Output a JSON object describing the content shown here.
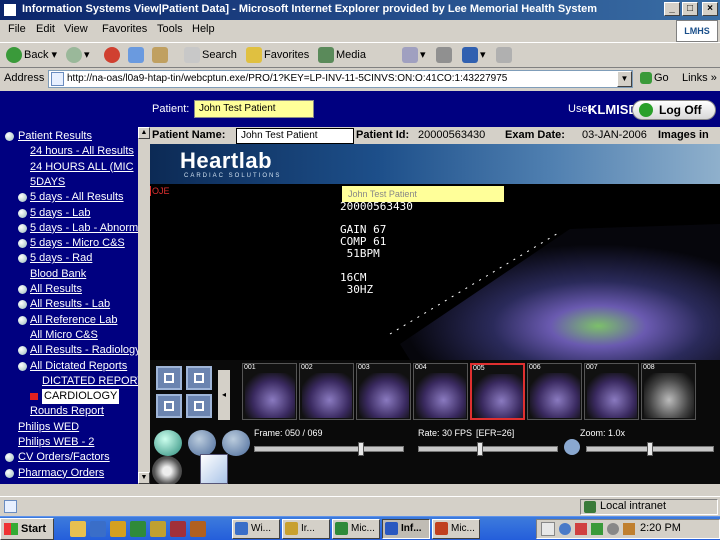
{
  "window": {
    "title": "Information Systems View|Patient Data] - Microsoft Internet Explorer provided by Lee Memorial Health System",
    "brand_badge": "LMHS"
  },
  "menu": [
    "File",
    "Edit",
    "View",
    "Favorites",
    "Tools",
    "Help"
  ],
  "toolbar": {
    "back": "Back",
    "search": "Search",
    "favorites": "Favorites",
    "media": "Media"
  },
  "address": {
    "label": "Address",
    "url": "http://na-oas/l0a9-htap-tin/webcptun.exe/PRO/1?KEY=LP-INV-11-5CINVS:ON:O:41CO:1:43227975",
    "go": "Go",
    "links": "Links"
  },
  "app": {
    "patient_label": "Patient:",
    "patient_value": "John Test Patient",
    "user_label": "User:",
    "user_value": "KLMISD",
    "logoff": "Log Off"
  },
  "sidebar": {
    "items": [
      {
        "label": "Patient Results",
        "bullet": true,
        "indent": 0
      },
      {
        "label": "24 hours - All Results",
        "bullet": false,
        "indent": 1
      },
      {
        "label": "24 HOURS ALL (MIC",
        "bullet": false,
        "indent": 1
      },
      {
        "label": "5DAYS",
        "bullet": false,
        "indent": 1
      },
      {
        "label": "5 days - All Results",
        "bullet": true,
        "indent": 1
      },
      {
        "label": "5 days - Lab",
        "bullet": true,
        "indent": 1
      },
      {
        "label": "5 days - Lab - Abnormal",
        "bullet": true,
        "indent": 1
      },
      {
        "label": "5 days - Micro C&S",
        "bullet": true,
        "indent": 1
      },
      {
        "label": "5 days - Rad",
        "bullet": true,
        "indent": 1
      },
      {
        "label": "Blood Bank",
        "bullet": false,
        "indent": 1
      },
      {
        "label": "All Results",
        "bullet": true,
        "indent": 1
      },
      {
        "label": "All Results - Lab",
        "bullet": true,
        "indent": 1
      },
      {
        "label": "All Reference Lab",
        "bullet": true,
        "indent": 1
      },
      {
        "label": "All Micro C&S",
        "bullet": false,
        "indent": 1
      },
      {
        "label": "All Results - Radiology",
        "bullet": true,
        "indent": 1
      },
      {
        "label": "All Dictated Reports",
        "bullet": true,
        "indent": 1
      },
      {
        "label": "DICTATED REPORT",
        "bullet": false,
        "indent": 2
      },
      {
        "label": "CARDIOLOGY",
        "bullet": false,
        "indent": 2,
        "selected": true
      },
      {
        "label": "Rounds Report",
        "bullet": false,
        "indent": 1
      },
      {
        "label": "Philips WED",
        "bullet": false,
        "indent": 0
      },
      {
        "label": "Philips WEB - 2",
        "bullet": false,
        "indent": 0
      },
      {
        "label": "CV Orders/Factors",
        "bullet": true,
        "indent": 0
      },
      {
        "label": "Pharmacy Orders",
        "bullet": true,
        "indent": 0
      }
    ]
  },
  "viewer": {
    "patient_name_label": "Patient Name:",
    "patient_name_value": "John Test Patient",
    "patient_id_label": "Patient Id:",
    "patient_id_value": "20000563430",
    "exam_date_label": "Exam Date:",
    "exam_date_value": "03-JAN-2006",
    "images_label": "Images in",
    "brand": "Heartlab",
    "brand_sub": "CARDIAC SOLUTIONS",
    "echo_name": "John Test Patient",
    "echo_id": "20000563430",
    "echo_params": "GAIN 67\nCOMP 61\n 51BPM\n\n16CM\n 30HZ",
    "echo_tag": "OJE",
    "thumbs": [
      "001",
      "002",
      "003",
      "004",
      "005",
      "006",
      "007",
      "008"
    ],
    "selected_thumb": "005",
    "frame_label": "Frame: 050 / 069",
    "rate_label": "Rate: 30 FPS",
    "efr_label": "[EFR=26]",
    "zoom_label": "Zoom: 1.0x",
    "frame_position": 0.72,
    "rate_position": 0.44,
    "zoom_position": 0.5
  },
  "status": {
    "zone": "Local intranet"
  },
  "taskbar": {
    "start": "Start",
    "tasks": [
      {
        "label": "Wi...",
        "color": "#3a6ec8"
      },
      {
        "label": "Ir...",
        "color": "#c8a030"
      },
      {
        "label": "Mic...",
        "color": "#2f8a3a"
      },
      {
        "label": "Inf...",
        "color": "#2a58c0",
        "active": true
      },
      {
        "label": "Mic...",
        "color": "#c04020"
      }
    ],
    "clock": "2:20 PM"
  }
}
